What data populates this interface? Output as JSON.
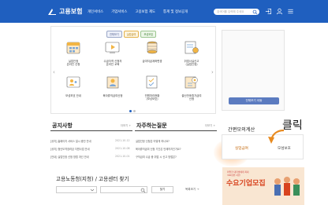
{
  "header": {
    "logo_text": "고용보험",
    "nav": [
      "개인서비스",
      "기업서비스",
      "고용보험 제도",
      "통계 및 정보공개"
    ],
    "search_placeholder": "검색어를 입력해 주세요"
  },
  "colors": {
    "header_bg": "#1f5fbf",
    "accent_orange": "#e88a1f"
  },
  "services": {
    "tags": [
      "전체보기",
      "실업급여",
      "모성보호"
    ],
    "items": [
      {
        "label": "실업인정\n온라인 신청",
        "icon": "document-calendar-icon"
      },
      {
        "label": "수급자격 신청자\n온라인 교육",
        "icon": "video-lecture-icon"
      },
      {
        "label": "급여지급계좌변경",
        "icon": "bank-account-icon"
      },
      {
        "label": "취업사실신고\n(실업인정)",
        "icon": "job-report-icon"
      },
      {
        "label": "모성보호 안내",
        "icon": "mother-child-icon"
      },
      {
        "label": "육아휴직급여신청",
        "icon": "childcare-leave-icon"
      },
      {
        "label": "민원처리현황\n(모성보호)",
        "icon": "progress-check-icon"
      },
      {
        "label": "출산전후휴가급여\n신청",
        "icon": "maternity-icon"
      }
    ]
  },
  "banner": {
    "button_label": "전체보기 이동"
  },
  "notice": {
    "title": "공지사항",
    "more": "더보기 +",
    "rows": [
      {
        "text": "[공지] 홈페이지 서비스 일시 중단 안내",
        "date": "2021-10-12"
      },
      {
        "text": "[공지] 청년도약장려금 지원사업 안내",
        "date": "2021-10-08"
      },
      {
        "text": "[안내] 실업인정 신청 방법 개선 안내",
        "date": "2021-10-01"
      }
    ]
  },
  "faq": {
    "title": "자주하는질문",
    "more": "더보기 +",
    "rows": [
      "실업인정 신청은 어떻게 하나요?",
      "육아휴직급여 신청 기간은 언제까지인가요?",
      "구직급여 수급 중 취업 시 신고 방법은?"
    ]
  },
  "calculator": {
    "title": "간편모의계산",
    "items": [
      "실업급여",
      "모성보호"
    ]
  },
  "annotation": {
    "text": "클릭"
  },
  "labor_office": {
    "title": "고용노동청(지청) / 고용센터 찾기",
    "select_placeholder": "선택하세요",
    "search_button": "찾기",
    "more_link": "목록보기 →"
  },
  "recruit_banner": {
    "top_text": "취업한 대학생에게 최대\n300만원 지원",
    "big_text": "수요기업모집"
  }
}
